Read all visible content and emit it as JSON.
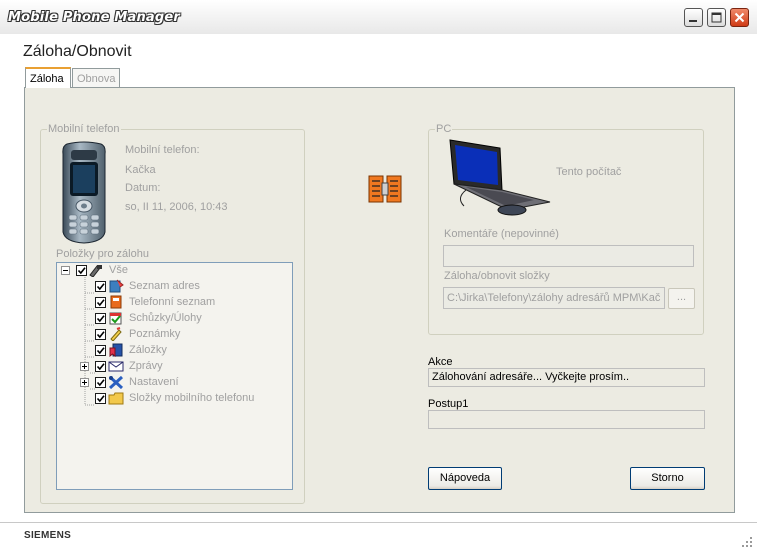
{
  "window": {
    "title": "Mobile Phone Manager",
    "buttons": [
      "minimize",
      "maximize",
      "close"
    ]
  },
  "page": {
    "heading": "Záloha/Obnovit",
    "tabs": [
      {
        "label": "Záloha",
        "active": true
      },
      {
        "label": "Obnova",
        "active": false
      }
    ]
  },
  "phone": {
    "group_label": "Mobilní telefon",
    "field_label": "Mobilní telefon:",
    "name": "Kačka",
    "date_label": "Datum:",
    "date": "so, II 11, 2006, 10:43",
    "icon": "mobile-phone-icon"
  },
  "tree": {
    "label": "Položky pro zálohu",
    "root": {
      "label": "Vše",
      "checked": true,
      "icon": "tools-icon"
    },
    "items": [
      {
        "label": "Seznam adres",
        "checked": true,
        "expandable": false,
        "icon": "address-book-icon"
      },
      {
        "label": "Telefonní seznam",
        "checked": true,
        "expandable": false,
        "icon": "phonebook-icon"
      },
      {
        "label": "Schůzky/Úlohy",
        "checked": true,
        "expandable": false,
        "icon": "calendar-check-icon"
      },
      {
        "label": "Poznámky",
        "checked": true,
        "expandable": false,
        "icon": "note-pen-icon"
      },
      {
        "label": "Záložky",
        "checked": true,
        "expandable": false,
        "icon": "bookmark-icon"
      },
      {
        "label": "Zprávy",
        "checked": true,
        "expandable": true,
        "icon": "envelope-icon"
      },
      {
        "label": "Nastavení",
        "checked": true,
        "expandable": true,
        "icon": "settings-tools-icon"
      },
      {
        "label": "Složky mobilního telefonu",
        "checked": true,
        "expandable": false,
        "icon": "folder-icon"
      }
    ]
  },
  "transfer": {
    "icon": "data-transfer-icon"
  },
  "pc": {
    "group_label": "PC",
    "computer_label": "Tento počítač",
    "icon": "laptop-icon",
    "comment_label": "Komentáře (nepovinné)",
    "comment_value": "",
    "folder_label": "Záloha/obnovit složky",
    "folder_value": "C:\\Jirka\\Telefony\\zálohy adresářů MPM\\Kač",
    "browse_label": "..."
  },
  "action": {
    "label": "Akce",
    "value": "Zálohování adresáře... Vyčkejte prosím.."
  },
  "progress": {
    "label": "Postup1",
    "fraction": 0
  },
  "buttons": {
    "help": "Nápoveda",
    "cancel": "Storno"
  },
  "status": {
    "brand": "SIEMENS"
  }
}
